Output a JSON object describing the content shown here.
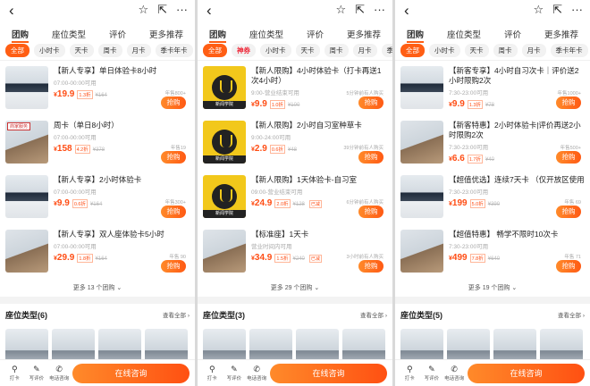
{
  "top_icons": {
    "back": "‹",
    "star": "☆",
    "share": "⇱",
    "more": "···"
  },
  "tabs": [
    "团购",
    "座位类型",
    "评价",
    "更多推荐"
  ],
  "panels": [
    {
      "chips": [
        "全部",
        "小时卡",
        "天卡",
        "周卡",
        "月卡",
        "季卡年卡"
      ],
      "chip_selected": 0,
      "deals": [
        {
          "title": "【新人专享】单日体验卡8小时",
          "sub": "07:00-00:00可用",
          "price": "19.9",
          "disc": "1.3折",
          "old": "¥164",
          "sold": "年售800+",
          "buy": "抢购",
          "thumb": "room"
        },
        {
          "title": "周卡（单日8小时）",
          "sub": "07:00-00:00可用",
          "price": "158",
          "disc": "4.2折",
          "old": "¥378",
          "sold": "年售19",
          "buy": "抢购",
          "thumb": "room2",
          "tag": "商家服务"
        },
        {
          "title": "【新人专享】2小时体验卡",
          "sub": "07:00-00:00可用",
          "price": "9.9",
          "disc": "0.6折",
          "old": "¥164",
          "sold": "年售300+",
          "buy": "抢购",
          "thumb": "room"
        },
        {
          "title": "【新人专享】双人座体验卡5小时",
          "sub": "07:00-00:00可用",
          "price": "29.9",
          "disc": "1.8折",
          "old": "¥164",
          "sold": "年售 90",
          "buy": "抢购",
          "thumb": "room2"
        }
      ],
      "more": "更多 13 个团购",
      "seat_title": "座位类型(6)",
      "seat_all": "查看全部 ›"
    },
    {
      "chips": [
        "全部",
        "神券",
        "小时卡",
        "天卡",
        "周卡",
        "月卡",
        "季卡"
      ],
      "chip_selected": 0,
      "deals": [
        {
          "title": "【新人限购】4小时体验卡（打卡再送1次4小时）",
          "sub": "9:00-营业结束可用",
          "price": "9.9",
          "disc": "1.0折",
          "old": "¥100",
          "sold": "5分钟前有人购买",
          "buy": "抢购",
          "thumb": "logo",
          "band": "新闻学院"
        },
        {
          "title": "【新人限购】2小时自习室种草卡",
          "sub": "9:00-24:00可用",
          "price": "2.9",
          "disc": "0.6折",
          "old": "¥48",
          "sold": "39分钟前有人购买",
          "buy": "抢购",
          "thumb": "logo",
          "band": "新闻学院"
        },
        {
          "title": "【新人限购】1天体验卡-自习室",
          "sub": "09:00-营业结束可用",
          "price": "24.9",
          "disc": "2.0折",
          "old": "¥128",
          "sold": "6分钟前有人购买",
          "buy": "抢购",
          "thumb": "logo",
          "band": "新闻学院",
          "extra": "已减"
        },
        {
          "title": "【标准座】1天卡",
          "sub": "营业时间内可用",
          "price": "34.9",
          "disc": "1.5折",
          "old": "¥240",
          "sold": "3小时前有人购买",
          "buy": "抢购",
          "thumb": "room2",
          "extra": "已减"
        }
      ],
      "more": "更多 29 个团购",
      "seat_title": "座位类型(3)",
      "seat_all": "查看全部 ›"
    },
    {
      "chips": [
        "全部",
        "小时卡",
        "天卡",
        "周卡",
        "月卡",
        "季卡年卡"
      ],
      "chip_selected": 0,
      "deals": [
        {
          "title": "【新客专享】4小时自习次卡｜评价送2小时限购2次",
          "sub": "7:30-23:00可用",
          "price": "9.9",
          "disc": "1.3折",
          "old": "¥78",
          "sold": "年售1000+",
          "buy": "抢购",
          "thumb": "room"
        },
        {
          "title": "【新客特惠】2小时体验卡|评价再送2小时限购2次",
          "sub": "7:30-23:00可用",
          "price": "6.6",
          "disc": "1.7折",
          "old": "¥40",
          "sold": "年售500+",
          "buy": "抢购",
          "thumb": "room2"
        },
        {
          "title": "【超值优选】连续7天卡 （仅开放区使用",
          "sub": "7:30-23:00可用",
          "price": "199",
          "disc": "5.0折",
          "old": "¥390",
          "sold": "年售 69",
          "buy": "抢购",
          "thumb": "room"
        },
        {
          "title": "【超值特惠】 畅学不限时10次卡",
          "sub": "7:30-23:00可用",
          "price": "499",
          "disc": "7.8折",
          "old": "¥640",
          "sold": "年售 71",
          "buy": "抢购",
          "thumb": "room2"
        }
      ],
      "more": "更多 19 个团购",
      "seat_title": "座位类型(5)",
      "seat_all": "查看全部 ›"
    }
  ],
  "bottom": {
    "items": [
      {
        "icon": "⚲",
        "label": "打卡"
      },
      {
        "icon": "✎",
        "label": "写评价"
      },
      {
        "icon": "✆",
        "label": "电话咨询"
      }
    ],
    "consult": "在线咨询"
  },
  "colors": {
    "accent": "#ff5e14",
    "price": "#ff4d14"
  }
}
